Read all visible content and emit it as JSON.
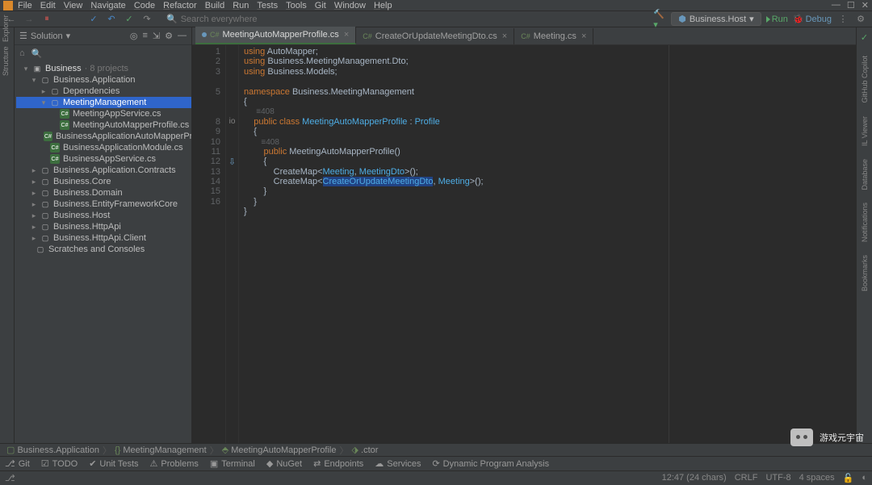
{
  "menubar": [
    "File",
    "Edit",
    "View",
    "Navigate",
    "Code",
    "Refactor",
    "Build",
    "Run",
    "Tests",
    "Tools",
    "Git",
    "Window",
    "Help"
  ],
  "toolbar": {
    "search_placeholder": "Search everywhere",
    "config": "Business.Host",
    "run_label": "Run",
    "debug_label": "Debug"
  },
  "sidebar": {
    "title": "Solution",
    "solution": {
      "name": "Business",
      "meta": "· 8 projects"
    },
    "tree": [
      {
        "ind": 18,
        "arrow": "▾",
        "icon": "folder",
        "label": "Business.Application"
      },
      {
        "ind": 30,
        "arrow": "▸",
        "icon": "folder",
        "label": "Dependencies"
      },
      {
        "ind": 30,
        "arrow": "▾",
        "icon": "folder",
        "label": "MeetingManagement",
        "selected": true
      },
      {
        "ind": 42,
        "arrow": "",
        "icon": "cs",
        "label": "MeetingAppService.cs"
      },
      {
        "ind": 42,
        "arrow": "",
        "icon": "cs",
        "label": "MeetingAutoMapperProfile.cs"
      },
      {
        "ind": 30,
        "arrow": "",
        "icon": "cs",
        "label": "BusinessApplicationAutoMapperProfile.cs"
      },
      {
        "ind": 30,
        "arrow": "",
        "icon": "cs",
        "label": "BusinessApplicationModule.cs"
      },
      {
        "ind": 30,
        "arrow": "",
        "icon": "cs",
        "label": "BusinessAppService.cs"
      },
      {
        "ind": 18,
        "arrow": "▸",
        "icon": "folder",
        "label": "Business.Application.Contracts"
      },
      {
        "ind": 18,
        "arrow": "▸",
        "icon": "folder",
        "label": "Business.Core"
      },
      {
        "ind": 18,
        "arrow": "▸",
        "icon": "folder",
        "label": "Business.Domain"
      },
      {
        "ind": 18,
        "arrow": "▸",
        "icon": "folder",
        "label": "Business.EntityFrameworkCore"
      },
      {
        "ind": 18,
        "arrow": "▸",
        "icon": "folder",
        "label": "Business.Host"
      },
      {
        "ind": 18,
        "arrow": "▸",
        "icon": "folder",
        "label": "Business.HttpApi"
      },
      {
        "ind": 18,
        "arrow": "▸",
        "icon": "folder",
        "label": "Business.HttpApi.Client"
      },
      {
        "ind": 12,
        "arrow": "",
        "icon": "folder",
        "label": "Scratches and Consoles"
      }
    ]
  },
  "tabs": [
    {
      "label": "MeetingAutoMapperProfile.cs",
      "active": true,
      "dirty": true
    },
    {
      "label": "CreateOrUpdateMeetingDto.cs",
      "active": false,
      "dirty": false
    },
    {
      "label": "Meeting.cs",
      "active": false,
      "dirty": false
    }
  ],
  "code": {
    "lines": [
      1,
      2,
      3,
      "",
      5,
      "",
      "",
      8,
      9,
      10,
      11,
      12,
      13,
      14,
      15,
      16
    ],
    "hint1": "≡408",
    "hint2": "≡408",
    "t": {
      "using": "using",
      "automapper": "AutoMapper",
      "dto": "Business.MeetingManagement.Dto",
      "models": "Business.Models",
      "namespace": "namespace",
      "nsname": "Business.MeetingManagement",
      "public": "public",
      "class": "class",
      "profile": "Profile",
      "classname": "MeetingAutoMapperProfile",
      "createmap": "CreateMap",
      "meeting": "Meeting",
      "meetingdto": "MeetingDto",
      "createdto": "CreateOrUpdateMeetingDto"
    }
  },
  "breadcrumb": [
    "Business.Application",
    "MeetingManagement",
    "MeetingAutoMapperProfile",
    ".ctor"
  ],
  "bottombar": [
    "Git",
    "TODO",
    "Unit Tests",
    "Problems",
    "Terminal",
    "NuGet",
    "Endpoints",
    "Services",
    "Dynamic Program Analysis"
  ],
  "statusbar": {
    "pos": "12:47 (24 chars)",
    "crlf": "CRLF",
    "enc": "UTF-8",
    "indent": "4 spaces"
  },
  "rightstrip": [
    "GitHub Copilot",
    "IL Viewer",
    "Database",
    "Notifications",
    "Bookmarks"
  ],
  "watermark": "游戏元宇宙"
}
